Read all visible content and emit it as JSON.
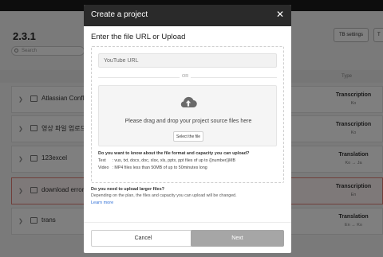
{
  "background": {
    "heading": "2.3.1",
    "search_placeholder": "Search",
    "toolbar": {
      "tb_settings": "TB settings",
      "t_partial": "T"
    },
    "column_type": "Type",
    "rows": [
      {
        "name": "Atlassian Conflu",
        "type": "Transcription",
        "lang": "Ko"
      },
      {
        "name": "영상 파일 업로드 테",
        "type": "Transcription",
        "lang": "Ko"
      },
      {
        "name": "123excel",
        "type": "Translation",
        "lang": "Ko → Ja"
      },
      {
        "name": "download error t",
        "type": "Transcription",
        "lang": "En",
        "selected": true
      },
      {
        "name": "trans",
        "type": "Translation",
        "lang": "En → Ko"
      }
    ]
  },
  "modal": {
    "title": "Create a project",
    "close_icon": "close-icon",
    "subtitle": "Enter the file URL or Upload",
    "url_placeholder": "YouTube URL",
    "or_text": "OR",
    "drop_text": "Please drag and drop your project source files here",
    "select_file_label": "Select the file",
    "info_question": "Do you want to know about the file format and capacity you can upload?",
    "info_text_label": "Text",
    "info_text_value": ": vus, txt, docx, doc, xlsx, xls, pptx, ppt files of up to {{number}}MB",
    "info_video_label": "Video",
    "info_video_value": ": MP4 files less than 50MB of up to 50minutes long",
    "larger_question": "Do you need to upload larger files?",
    "larger_desc": "Depending on the plan, the files and capacity you can upload will be changed.",
    "learn_more": "Learn more",
    "cancel_label": "Cancel",
    "next_label": "Next"
  },
  "colors": {
    "header": "#2a2a2a",
    "next_disabled": "#a6a6a6",
    "link": "#2f6fd6",
    "selected_row_border": "#e07d74"
  }
}
